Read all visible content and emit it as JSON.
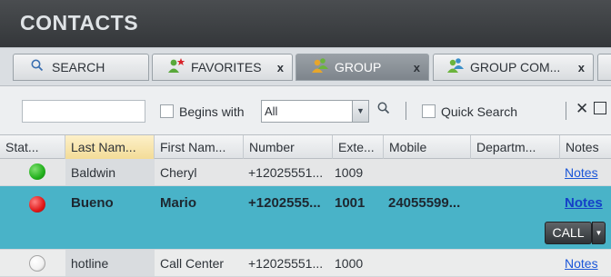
{
  "panel": {
    "title": "CONTACTS"
  },
  "tabs": [
    {
      "label": "SEARCH",
      "icon": "search-icon",
      "active": false
    },
    {
      "label": "FAVORITES",
      "icon": "favorites-icon",
      "close": "x",
      "active": false
    },
    {
      "label": "GROUP",
      "icon": "group-icon",
      "close": "x",
      "active": true
    },
    {
      "label": "GROUP COM...",
      "icon": "group-icon",
      "close": "x",
      "active": false
    }
  ],
  "search": {
    "input_value": "",
    "begins_with_label": "Begins with",
    "filter_value": "All",
    "quick_search_label": "Quick Search"
  },
  "columns": [
    "Stat...",
    "Last Nam...",
    "First Nam...",
    "Number",
    "Exte...",
    "Mobile",
    "Departm...",
    "Notes"
  ],
  "rows": [
    {
      "status": "available",
      "status_color": "#22b01c",
      "last": "Baldwin",
      "first": "Cheryl",
      "number": "+12025551...",
      "ext": "1009",
      "mobile": "",
      "dept": "",
      "notes": "Notes"
    },
    {
      "status": "busy",
      "status_color": "#e01818",
      "last": "Bueno",
      "first": "Mario",
      "number": "+1202555...",
      "ext": "1001",
      "mobile": "24055599...",
      "dept": "",
      "notes": "Notes",
      "call_label": "CALL"
    },
    {
      "status": "offline",
      "status_color": "#ffffff",
      "last": "hotline",
      "first": "Call Center",
      "number": "+12025551...",
      "ext": "1000",
      "mobile": "",
      "dept": "",
      "notes": "Notes"
    }
  ],
  "colors": {
    "titlebar": "#3c3f42",
    "selected_row": "#49b3c8",
    "sorted_header": "#f3dc97",
    "link": "#1a56d8"
  }
}
